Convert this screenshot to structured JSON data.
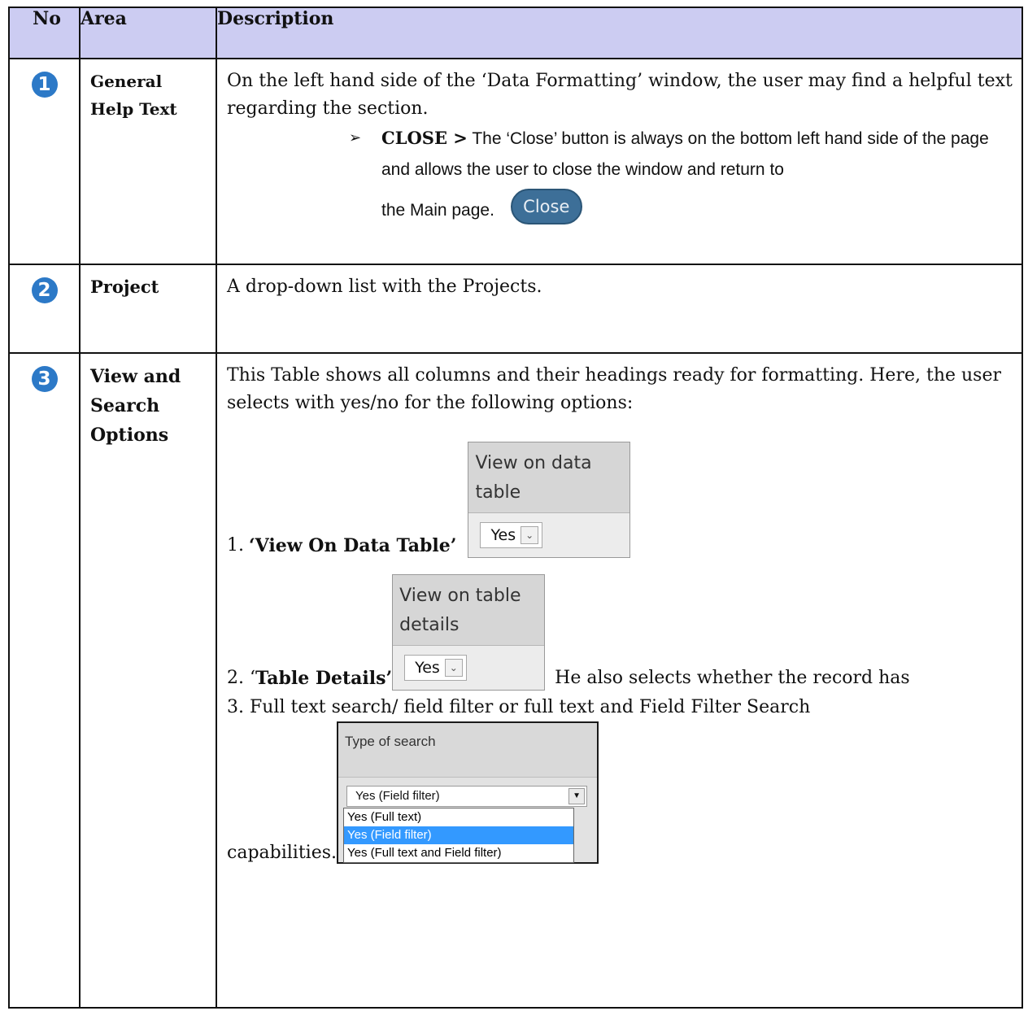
{
  "table": {
    "headers": {
      "no": "No",
      "area": "Area",
      "description": "Description"
    },
    "rows": [
      {
        "number": "1",
        "area": "General Help Text",
        "description": "On the left hand side of the ‘Data Formatting’ window, the user may find a helpful text regarding the section.",
        "bullet": {
          "label": "CLOSE >",
          "text": "The ‘Close’ button is always on the bottom left hand side of the page and allows the user to close the window and return to",
          "text_end": "the Main page.",
          "button_label": "Close"
        }
      },
      {
        "number": "2",
        "area": "Project",
        "description": "A drop-down list with the Projects."
      },
      {
        "number": "3",
        "area_line1": "View and",
        "area_line2": "Search",
        "area_line3": "Options",
        "description": "This Table shows all columns and their headings ready for formatting. Here, the user selects with yes/no for the following options:",
        "item1": {
          "prefix": "1.",
          "label": "‘View On Data Table’",
          "widget_head": "View on data table",
          "widget_value": "Yes"
        },
        "item2": {
          "prefix": "2. ‘",
          "label": "Table Details’",
          "widget_head": "View on table details",
          "widget_value": "Yes",
          "after": "He also selects whether the record has"
        },
        "item3": {
          "text": "3. Full text search/ field filter or full text and Field Filter Search",
          "widget_head": "Type of search",
          "selected_value": "Yes (Field filter)",
          "options": [
            "Yes (Full text)",
            "Yes (Field filter)",
            "Yes (Full text and Field filter)"
          ],
          "highlighted_option": "Yes (Field filter)",
          "trailing": "capabilities."
        }
      }
    ]
  },
  "colors": {
    "header_bg": "#ccccf2",
    "badge": "#2c79c7",
    "close_button": "#3d6f98",
    "option_highlight": "#3399ff"
  }
}
